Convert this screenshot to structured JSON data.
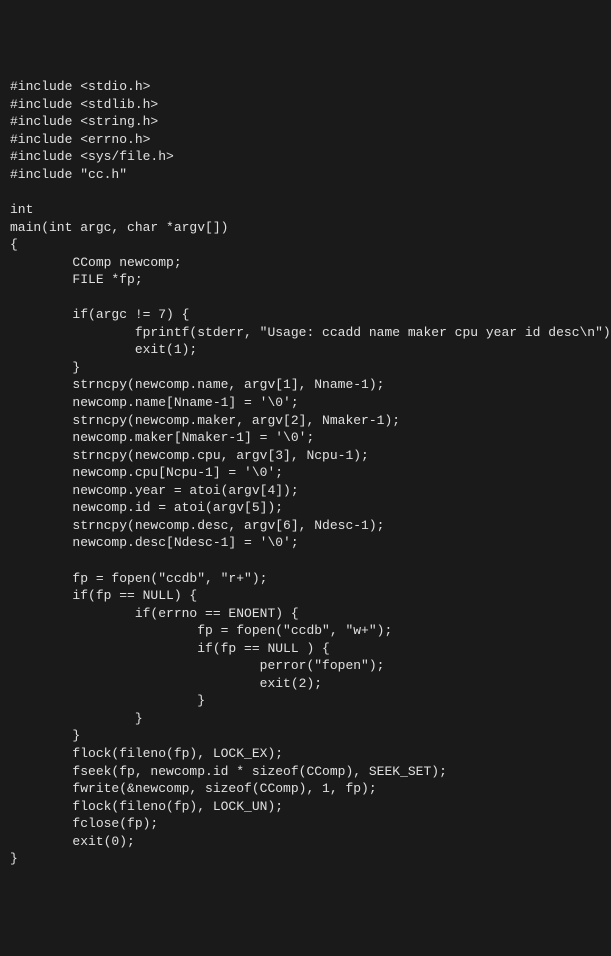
{
  "code": {
    "line1": "#include <stdio.h>",
    "line2": "#include <stdlib.h>",
    "line3": "#include <string.h>",
    "line4": "#include <errno.h>",
    "line5": "#include <sys/file.h>",
    "line6": "#include \"cc.h\"",
    "line7": "",
    "line8": "int",
    "line9": "main(int argc, char *argv[])",
    "line10": "{",
    "line11": "        CComp newcomp;",
    "line12": "        FILE *fp;",
    "line13": "",
    "line14": "        if(argc != 7) {",
    "line15": "                fprintf(stderr, \"Usage: ccadd name maker cpu year id desc\\n\");",
    "line16": "                exit(1);",
    "line17": "        }",
    "line18": "        strncpy(newcomp.name, argv[1], Nname-1);",
    "line19": "        newcomp.name[Nname-1] = '\\0';",
    "line20": "        strncpy(newcomp.maker, argv[2], Nmaker-1);",
    "line21": "        newcomp.maker[Nmaker-1] = '\\0';",
    "line22": "        strncpy(newcomp.cpu, argv[3], Ncpu-1);",
    "line23": "        newcomp.cpu[Ncpu-1] = '\\0';",
    "line24": "        newcomp.year = atoi(argv[4]);",
    "line25": "        newcomp.id = atoi(argv[5]);",
    "line26": "        strncpy(newcomp.desc, argv[6], Ndesc-1);",
    "line27": "        newcomp.desc[Ndesc-1] = '\\0';",
    "line28": "",
    "line29": "        fp = fopen(\"ccdb\", \"r+\");",
    "line30": "        if(fp == NULL) {",
    "line31": "                if(errno == ENOENT) {",
    "line32": "                        fp = fopen(\"ccdb\", \"w+\");",
    "line33": "                        if(fp == NULL ) {",
    "line34": "                                perror(\"fopen\");",
    "line35": "                                exit(2);",
    "line36": "                        }",
    "line37": "                }",
    "line38": "        }",
    "line39": "        flock(fileno(fp), LOCK_EX);",
    "line40": "        fseek(fp, newcomp.id * sizeof(CComp), SEEK_SET);",
    "line41": "        fwrite(&newcomp, sizeof(CComp), 1, fp);",
    "line42": "        flock(fileno(fp), LOCK_UN);",
    "line43": "        fclose(fp);",
    "line44": "        exit(0);",
    "line45": "}"
  }
}
